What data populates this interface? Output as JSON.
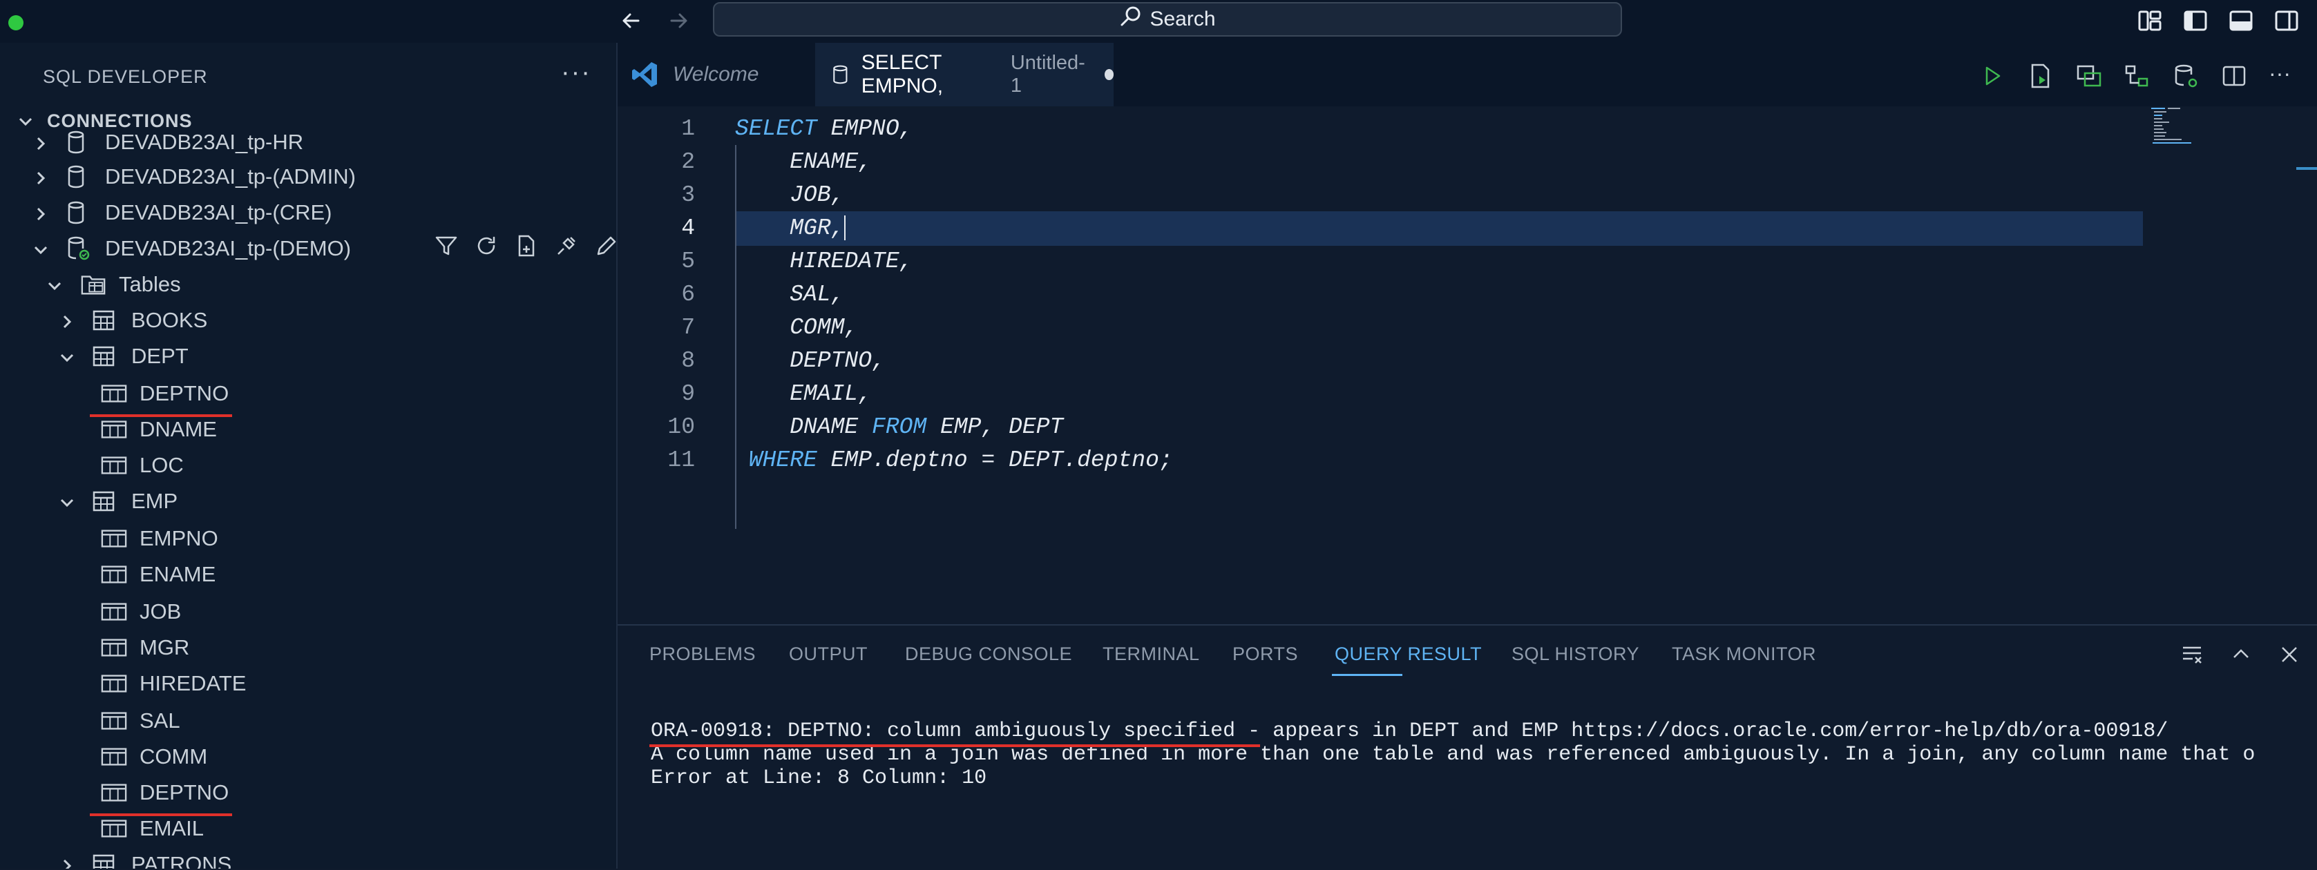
{
  "titlebar": {
    "search_label": "Search"
  },
  "sidebar": {
    "title": "SQL DEVELOPER",
    "more_label": "···",
    "section": "CONNECTIONS",
    "items": [
      {
        "label": "DEVADB23AI_tp-HR"
      },
      {
        "label": "DEVADB23AI_tp-(ADMIN)"
      },
      {
        "label": "DEVADB23AI_tp-(CRE)"
      },
      {
        "label": "DEVADB23AI_tp-(DEMO)"
      },
      {
        "label": "Tables"
      },
      {
        "label": "BOOKS"
      },
      {
        "label": "DEPT"
      },
      {
        "label": "DEPTNO"
      },
      {
        "label": "DNAME"
      },
      {
        "label": "LOC"
      },
      {
        "label": "EMP"
      },
      {
        "label": "EMPNO"
      },
      {
        "label": "ENAME"
      },
      {
        "label": "JOB"
      },
      {
        "label": "MGR"
      },
      {
        "label": "HIREDATE"
      },
      {
        "label": "SAL"
      },
      {
        "label": "COMM"
      },
      {
        "label": "DEPTNO"
      },
      {
        "label": "EMAIL"
      },
      {
        "label": "PATRONS"
      }
    ]
  },
  "editor": {
    "tabs": [
      {
        "label": "Welcome"
      },
      {
        "label": "SELECT EMPNO,",
        "sub": "Untitled-1"
      }
    ],
    "lines": [
      {
        "num": "1",
        "kw": "SELECT",
        "text": " EMPNO,"
      },
      {
        "num": "2",
        "kw": "",
        "text": "    ENAME,"
      },
      {
        "num": "3",
        "kw": "",
        "text": "    JOB,"
      },
      {
        "num": "4",
        "kw": "",
        "text": "    MGR,"
      },
      {
        "num": "5",
        "kw": "",
        "text": "    HIREDATE,"
      },
      {
        "num": "6",
        "kw": "",
        "text": "    SAL,"
      },
      {
        "num": "7",
        "kw": "",
        "text": "    COMM,"
      },
      {
        "num": "8",
        "kw": "",
        "text": "    DEPTNO,"
      },
      {
        "num": "9",
        "kw": "",
        "text": "    EMAIL,"
      },
      {
        "num": "10",
        "kw": "",
        "text": "    DNAME ",
        "kw2": "FROM",
        "text2": " EMP, DEPT"
      },
      {
        "num": "11",
        "kw": " WHERE",
        "text": " EMP.deptno = DEPT.deptno;"
      }
    ]
  },
  "panel": {
    "tabs": [
      {
        "label": "PROBLEMS"
      },
      {
        "label": "OUTPUT"
      },
      {
        "label": "DEBUG CONSOLE"
      },
      {
        "label": "TERMINAL"
      },
      {
        "label": "PORTS"
      },
      {
        "label": "QUERY RESULT"
      },
      {
        "label": "SQL HISTORY"
      },
      {
        "label": "TASK MONITOR"
      }
    ],
    "output": [
      "ORA-00918: DEPTNO: column ambiguously specified - appears in DEPT and EMP https://docs.oracle.com/error-help/db/ora-00918/",
      "A column name used in a join was defined in more than one table and was referenced ambiguously. In a join, any column name that o",
      "Error at Line: 8 Column: 10"
    ]
  },
  "colors": {
    "accent": "#5fb4f4",
    "error_underline": "#e0302a",
    "background": "#0f1b2d"
  }
}
